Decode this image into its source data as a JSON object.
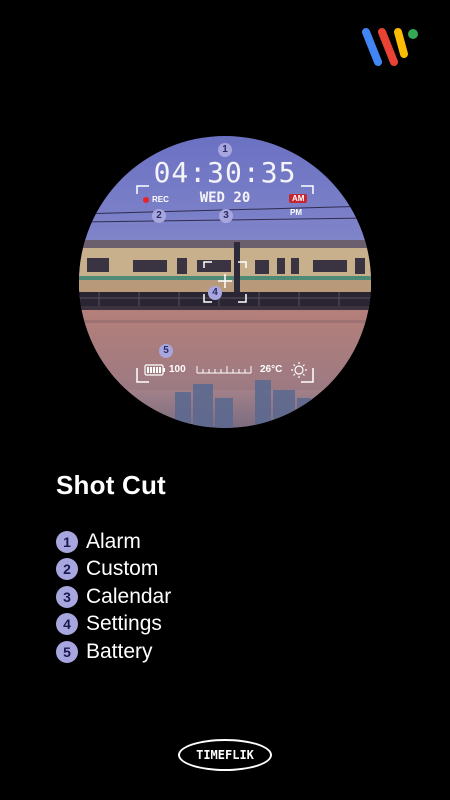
{
  "colors": {
    "background": "#000000",
    "badge_fill": "#a8a6df",
    "badge_text": "#1b1850",
    "rec_red": "#e8232b",
    "am_red": "#c8262e",
    "wear_blue": "#4285f4",
    "wear_yellow": "#fbbc05",
    "wear_red": "#ea4335",
    "wear_green": "#34a853"
  },
  "header": {
    "logo_icon": "wear-os-icon"
  },
  "watch_face": {
    "time": "04:30:35",
    "date": "WED 20",
    "rec_label": "REC",
    "am_label": "AM",
    "pm_label": "PM",
    "battery_value": "100",
    "temperature": "26°C",
    "weather_icon": "sun-icon",
    "battery_icon": "battery-icon",
    "callouts": [
      "1",
      "2",
      "3",
      "4",
      "5"
    ]
  },
  "content": {
    "title": "Shot Cut",
    "features": [
      {
        "num": "1",
        "label": "Alarm"
      },
      {
        "num": "2",
        "label": "Custom"
      },
      {
        "num": "3",
        "label": "Calendar"
      },
      {
        "num": "4",
        "label": "Settings"
      },
      {
        "num": "5",
        "label": "Battery"
      }
    ]
  },
  "footer": {
    "brand": "TIMEFLIK"
  }
}
